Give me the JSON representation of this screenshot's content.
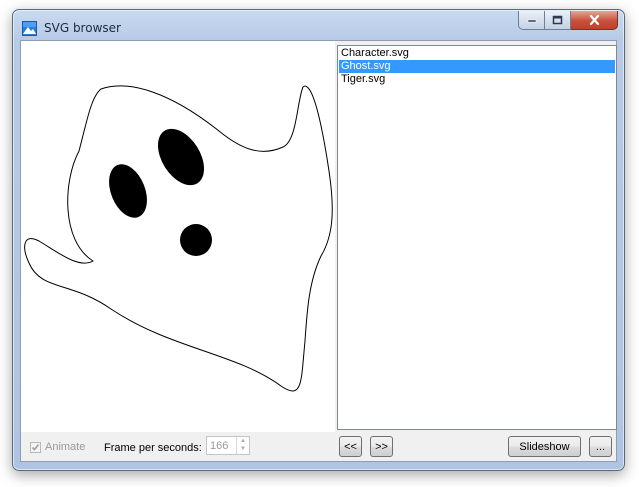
{
  "window": {
    "title": "SVG browser",
    "app_icon": "image-icon",
    "caption": {
      "minimize": "minimize-icon",
      "maximize": "maximize-icon",
      "close": "close-icon"
    }
  },
  "files": [
    {
      "name": "Character.svg",
      "selected": false
    },
    {
      "name": "Ghost.svg",
      "selected": true
    },
    {
      "name": "Tiger.svg",
      "selected": false
    }
  ],
  "controls": {
    "animate_label": "Animate",
    "animate_checked": true,
    "animate_enabled": false,
    "fps_label": "Frame per seconds:",
    "fps_value": "166",
    "prev_label": "<<",
    "next_label": ">>",
    "slideshow_label": "Slideshow",
    "more_label": "..."
  },
  "colors": {
    "selection": "#3399ff",
    "close_button": "#c7503a"
  }
}
